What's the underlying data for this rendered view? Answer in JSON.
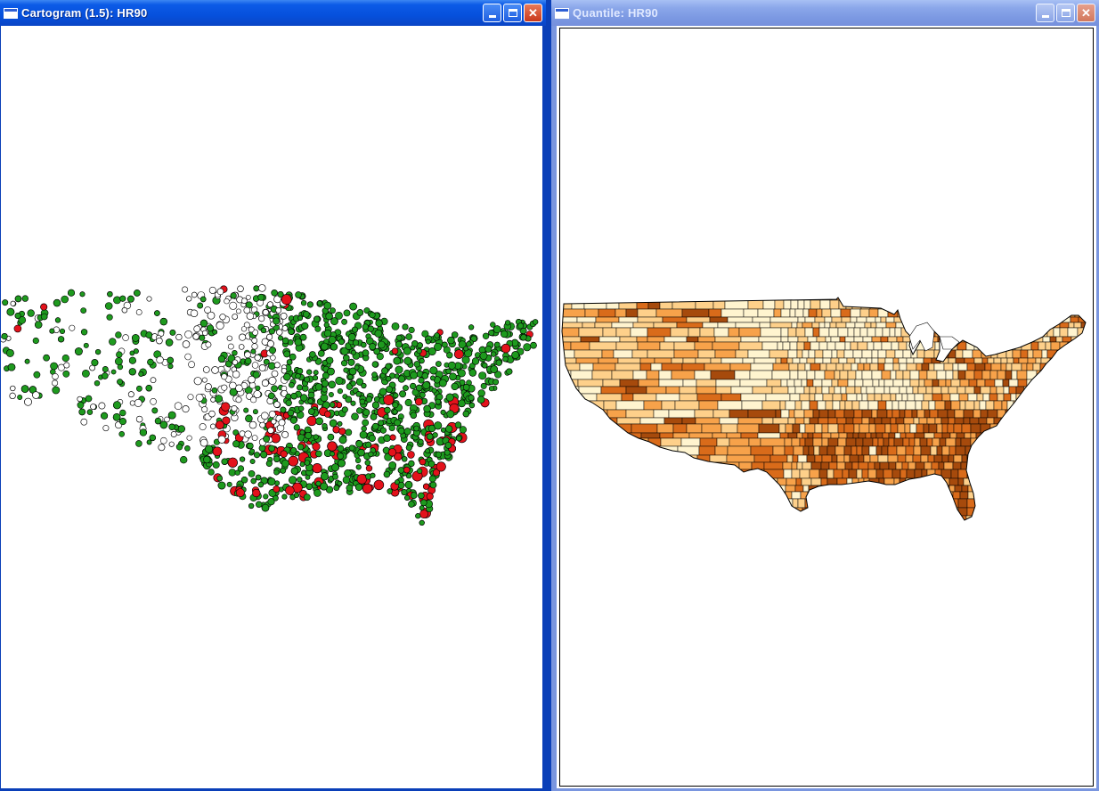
{
  "windows": {
    "left": {
      "title": "Cartogram (1.5): HR90",
      "active": true
    },
    "right": {
      "title": "Quantile: HR90",
      "active": false
    }
  },
  "controls": {
    "minimize": "minimize-icon",
    "maximize": "maximize-icon",
    "close": "close-icon"
  },
  "colors": {
    "desktop": "#0a3fb8",
    "cartogram_high": "#e3121b",
    "cartogram_mid": "#1e9a1e",
    "cartogram_low": "#ffffff",
    "quantile": [
      "#fff4cf",
      "#fed08a",
      "#f7a24a",
      "#d96b1a",
      "#a64a0c"
    ]
  }
}
